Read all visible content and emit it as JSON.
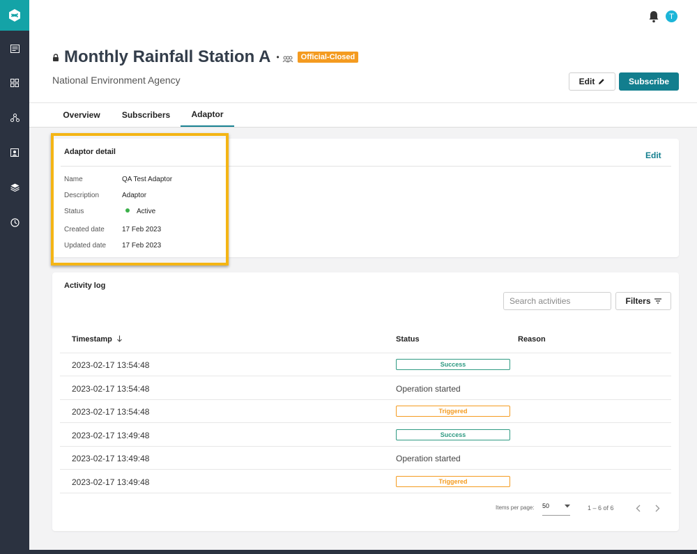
{
  "header": {
    "title": "Monthly Rainfall Station A",
    "separator": "•",
    "badge": "Official-Closed",
    "agency": "National Environment Agency",
    "avatar_initial": "T",
    "edit_label": "Edit",
    "subscribe_label": "Subscribe",
    "accent_color": "#127e8e",
    "badge_color": "#f49b20"
  },
  "tabs": [
    {
      "label": "Overview"
    },
    {
      "label": "Subscribers"
    },
    {
      "label": "Adaptor",
      "active": true
    }
  ],
  "adaptor_detail": {
    "title": "Adaptor detail",
    "edit_label": "Edit",
    "fields": [
      {
        "label": "Name",
        "value": "QA Test Adaptor"
      },
      {
        "label": "Description",
        "value": "Adaptor"
      },
      {
        "label": "Status",
        "value": "Active"
      },
      {
        "label": "Created date",
        "value": "17 Feb 2023"
      },
      {
        "label": "Updated date",
        "value": "17 Feb 2023"
      }
    ]
  },
  "activity_log": {
    "title": "Activity log",
    "search_placeholder": "Search activities",
    "filters_label": "Filters",
    "columns": {
      "timestamp": "Timestamp",
      "status": "Status",
      "reason": "Reason"
    },
    "rows": [
      {
        "timestamp": "2023-02-17 13:54:48",
        "status": "Success",
        "type": "success"
      },
      {
        "timestamp": "2023-02-17 13:54:48",
        "status": "Operation started",
        "type": "text"
      },
      {
        "timestamp": "2023-02-17 13:54:48",
        "status": "Triggered",
        "type": "triggered"
      },
      {
        "timestamp": "2023-02-17 13:49:48",
        "status": "Success",
        "type": "success"
      },
      {
        "timestamp": "2023-02-17 13:49:48",
        "status": "Operation started",
        "type": "text"
      },
      {
        "timestamp": "2023-02-17 13:49:48",
        "status": "Triggered",
        "type": "triggered"
      }
    ],
    "pagination": {
      "items_per_page_label": "Items per page:",
      "items_per_page": "50",
      "range": "1 – 6 of 6"
    }
  }
}
